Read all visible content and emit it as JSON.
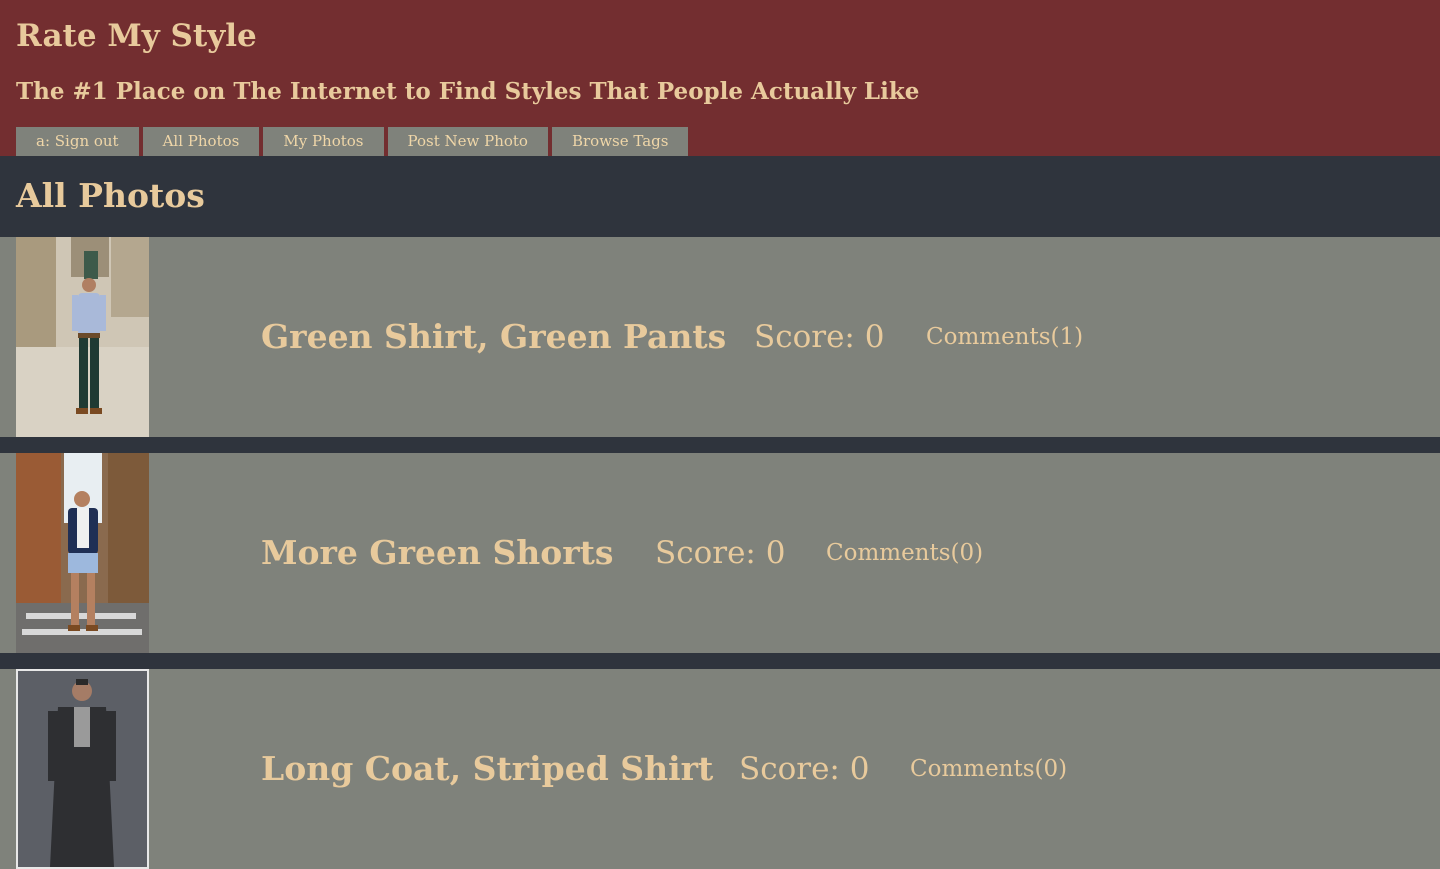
{
  "header": {
    "title": "Rate My Style",
    "subtitle": "The #1 Place on The Internet to Find Styles That People Actually Like",
    "nav": [
      {
        "label": "a: Sign out"
      },
      {
        "label": "All Photos"
      },
      {
        "label": "My Photos"
      },
      {
        "label": "Post New Photo"
      },
      {
        "label": "Browse Tags"
      }
    ]
  },
  "main": {
    "heading": "All Photos",
    "photos": [
      {
        "title": "Green Shirt, Green Pants",
        "score": "Score: 0",
        "comments": "Comments(1)"
      },
      {
        "title": "More Green Shorts",
        "score": "Score: 0",
        "comments": "Comments(0)"
      },
      {
        "title": "Long Coat, Striped Shirt",
        "score": "Score: 0",
        "comments": "Comments(0)"
      }
    ]
  },
  "colors": {
    "header_bg": "#732e30",
    "page_bg": "#2f343d",
    "row_bg": "#7f827b",
    "text": "#e8ca9c"
  }
}
